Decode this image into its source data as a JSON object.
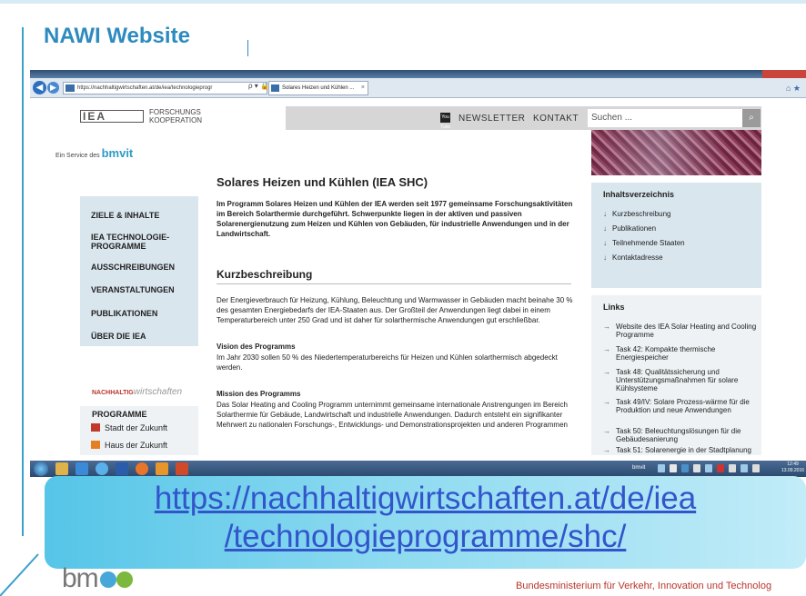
{
  "slide": {
    "title": "NAWI Website",
    "url_line1": "https://nachhaltigwirtschaften.at/de/iea",
    "url_line2": "/technologieprogramme/shc/",
    "footer_logo": "bm",
    "ministry": "Bundesministerium für Verkehr, Innovation und Technolog"
  },
  "browser": {
    "address": "https://nachhaltigwirtschaften.at/de/iea/technologieprogr",
    "address_tools": "ρ ▾ 🔒 ↻",
    "tab_title": "Solares Heizen und Kühlen ...",
    "back_icon": "back-arrow-icon",
    "forward_icon": "forward-arrow-icon"
  },
  "header": {
    "logo_mark": "IEA",
    "logo_line1": "FORSCHUNGS",
    "logo_line2": "KOOPERATION",
    "service_prefix": "Ein Service des",
    "service_logo": "bmvit",
    "newsletter": "NEWSLETTER",
    "kontakt": "KONTAKT",
    "search_placeholder": "Suchen ...",
    "youtube_label": "You Tube"
  },
  "sidebar": {
    "items": [
      {
        "label": "ZIELE & INHALTE"
      },
      {
        "label": "IEA TECHNOLOGIE-PROGRAMME"
      },
      {
        "label": "AUSSCHREIBUNGEN"
      },
      {
        "label": "VERANSTALTUNGEN"
      },
      {
        "label": "PUBLIKATIONEN"
      },
      {
        "label": "ÜBER DIE IEA"
      }
    ],
    "nach_bold": "NACHHALTIG",
    "nach_ital": "wirtschaften",
    "programme_head": "PROGRAMME",
    "programme_items": [
      {
        "label": "Stadt der Zukunft",
        "color": "#c0392b"
      },
      {
        "label": "Haus der Zukunft",
        "color": "#e67e22"
      }
    ]
  },
  "main": {
    "title": "Solares Heizen und Kühlen (IEA SHC)",
    "intro": "Im Programm Solares Heizen und Kühlen der IEA werden seit 1977 gemeinsame Forschungsaktivitäten im Bereich Solarthermie durchgeführt. Schwerpunkte liegen in der aktiven und passiven Solarenergienutzung zum Heizen und Kühlen von Gebäuden, für industrielle Anwendungen und in der Landwirtschaft.",
    "section_title": "Kurzbeschreibung",
    "section_text": "Der Energieverbrauch für Heizung, Kühlung, Beleuchtung und Warmwasser in Gebäuden macht beinahe 30 % des gesamten Energiebedarfs der IEA-Staaten aus. Der Großteil der Anwendungen liegt dabei in einem Temperaturbereich unter 250 Grad und ist daher für solarthermische Anwendungen gut erschließbar.",
    "vision_title": "Vision des Programms",
    "vision_text": "Im Jahr 2030 sollen 50 % des Niedertemperaturbereichs für Heizen und Kühlen solarthermisch abgedeckt werden.",
    "mission_title": "Mission des Programms",
    "mission_text": "Das Solar Heating and Cooling Programm unternimmt gemeinsame internationale Anstrengungen im Bereich Solarthermie für Gebäude, Landwirtschaft und industrielle Anwendungen. Dadurch entsteht ein signifikanter Mehrwert zu nationalen Forschungs-, Entwicklungs- und Demonstrationsprojekten und anderen Programmen"
  },
  "toc": {
    "title": "Inhaltsverzeichnis",
    "items": [
      {
        "label": "Kurzbeschreibung"
      },
      {
        "label": "Publikationen"
      },
      {
        "label": "Teilnehmende Staaten"
      },
      {
        "label": "Kontaktadresse"
      }
    ]
  },
  "links": {
    "title": "Links",
    "items": [
      {
        "label": "Website des IEA Solar Heating and Cooling Programme"
      },
      {
        "label": "Task 42: Kompakte thermische Energiespeicher"
      },
      {
        "label": "Task 48: Qualitätssicherung und Unterstützungsmaßnahmen für solare Kühlsysteme"
      },
      {
        "label": "Task 49/IV: Solare Prozess-wärme für die Produktion und neue Anwendungen"
      },
      {
        "label": "Task 50: Beleuchtungslösungen für die Gebäudesanierung"
      },
      {
        "label": "Task 51: Solarenergie in der Stadtplanung"
      }
    ]
  },
  "taskbar": {
    "tray_label": "bmvit",
    "time": "12:49",
    "date": "13.09.2016"
  }
}
